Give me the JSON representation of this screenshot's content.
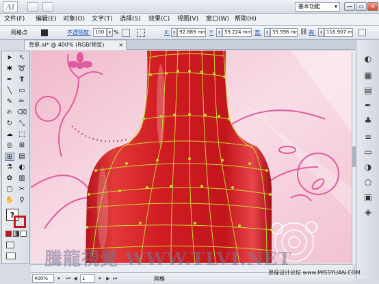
{
  "app": {
    "logo": "Ai",
    "workspace": "基本功能",
    "window_buttons": [
      "—",
      "▭",
      "✕"
    ]
  },
  "menu": [
    "文件(F)",
    "编辑(E)",
    "对象(O)",
    "文字(T)",
    "选择(S)",
    "效果(C)",
    "视图(V)",
    "窗口(W)",
    "帮助(H)"
  ],
  "control": {
    "selection_label": "网格点",
    "opacity_label": "不透明度:",
    "opacity_value": "100",
    "percent": "%",
    "x_label": "X:",
    "x_value": "92.889 mm",
    "y_label": "Y:",
    "y_value": "59.224 mm",
    "w_label": "宽:",
    "w_value": "35.596 mm",
    "h_label": "高:",
    "h_value": "116.907 mm"
  },
  "document": {
    "tab_title": "背景.ai* @ 400% (RGB/预览)",
    "close": "×"
  },
  "status": {
    "zoom": "400%",
    "page": "1",
    "status_text": "网格"
  },
  "overlay": {
    "watermark": "騰龍視覺 WWW.TLVI.NET",
    "site": "思缘设计论坛 www.MISSYUAN.COM"
  },
  "colors": {
    "bottle": "#c8161e",
    "mesh": "#c8d832",
    "background": "#f3c6d2",
    "flower": "#e05aa0"
  }
}
